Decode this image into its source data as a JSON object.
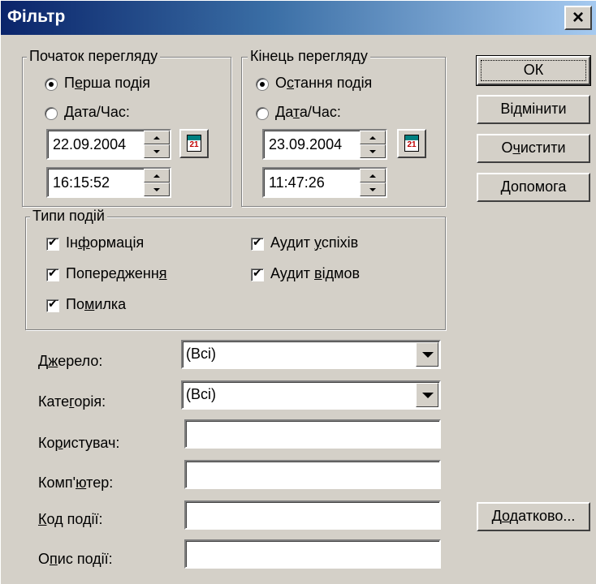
{
  "window": {
    "title": "Фільтр",
    "close_label": "×"
  },
  "start": {
    "legend": "Початок перегляду",
    "radio_first": {
      "pre": "П",
      "ul": "е",
      "post": "рша подія"
    },
    "radio_date": {
      "pre": "",
      "ul": "Д",
      "post": "ата/Час:"
    },
    "date": "22.09.2004",
    "time": "16:15:52",
    "calendar_day": "21"
  },
  "end": {
    "legend": "Кінець перегляду",
    "radio_last": {
      "pre": "О",
      "ul": "с",
      "post": "тання подія"
    },
    "radio_date": {
      "pre": "Да",
      "ul": "т",
      "post": "а/Час:"
    },
    "date": "23.09.2004",
    "time": "11:47:26",
    "calendar_day": "21"
  },
  "types": {
    "legend": "Типи подій",
    "info": {
      "pre": "Ін",
      "ul": "ф",
      "post": "ормація"
    },
    "warning": {
      "pre": "Попередженн",
      "ul": "я",
      "post": ""
    },
    "error": {
      "pre": "По",
      "ul": "м",
      "post": "илка"
    },
    "audit_success": {
      "pre": "Аудит ",
      "ul": "у",
      "post": "спіхів"
    },
    "audit_failure": {
      "pre": "Аудит ",
      "ul": "в",
      "post": "ідмов"
    }
  },
  "fields": {
    "source": {
      "pre": "Д",
      "ul": "ж",
      "post": "ерело:",
      "value": "(Всі)"
    },
    "category": {
      "pre": "Кате",
      "ul": "г",
      "post": "орія:",
      "value": "(Всі)"
    },
    "user": {
      "pre": "Ко",
      "ul": "р",
      "post": "истувач:",
      "value": ""
    },
    "computer": {
      "pre": "Комп'",
      "ul": "ю",
      "post": "тер:",
      "value": ""
    },
    "event_id": {
      "pre": "",
      "ul": "К",
      "post": "од події:",
      "value": ""
    },
    "description": {
      "pre": "О",
      "ul": "п",
      "post": "ис події:",
      "value": ""
    }
  },
  "buttons": {
    "ok": "ОК",
    "cancel": "Відмінити",
    "clear": {
      "pre": "О",
      "ul": "ч",
      "post": "истити"
    },
    "help": {
      "pre": "",
      "ul": "Д",
      "post": "опомога"
    },
    "advanced": {
      "pre": "Д",
      "ul": "о",
      "post": "датково..."
    }
  },
  "colors": {
    "face": "#d4d0c8",
    "title_start": "#0a246a",
    "title_end": "#a6caf0"
  }
}
